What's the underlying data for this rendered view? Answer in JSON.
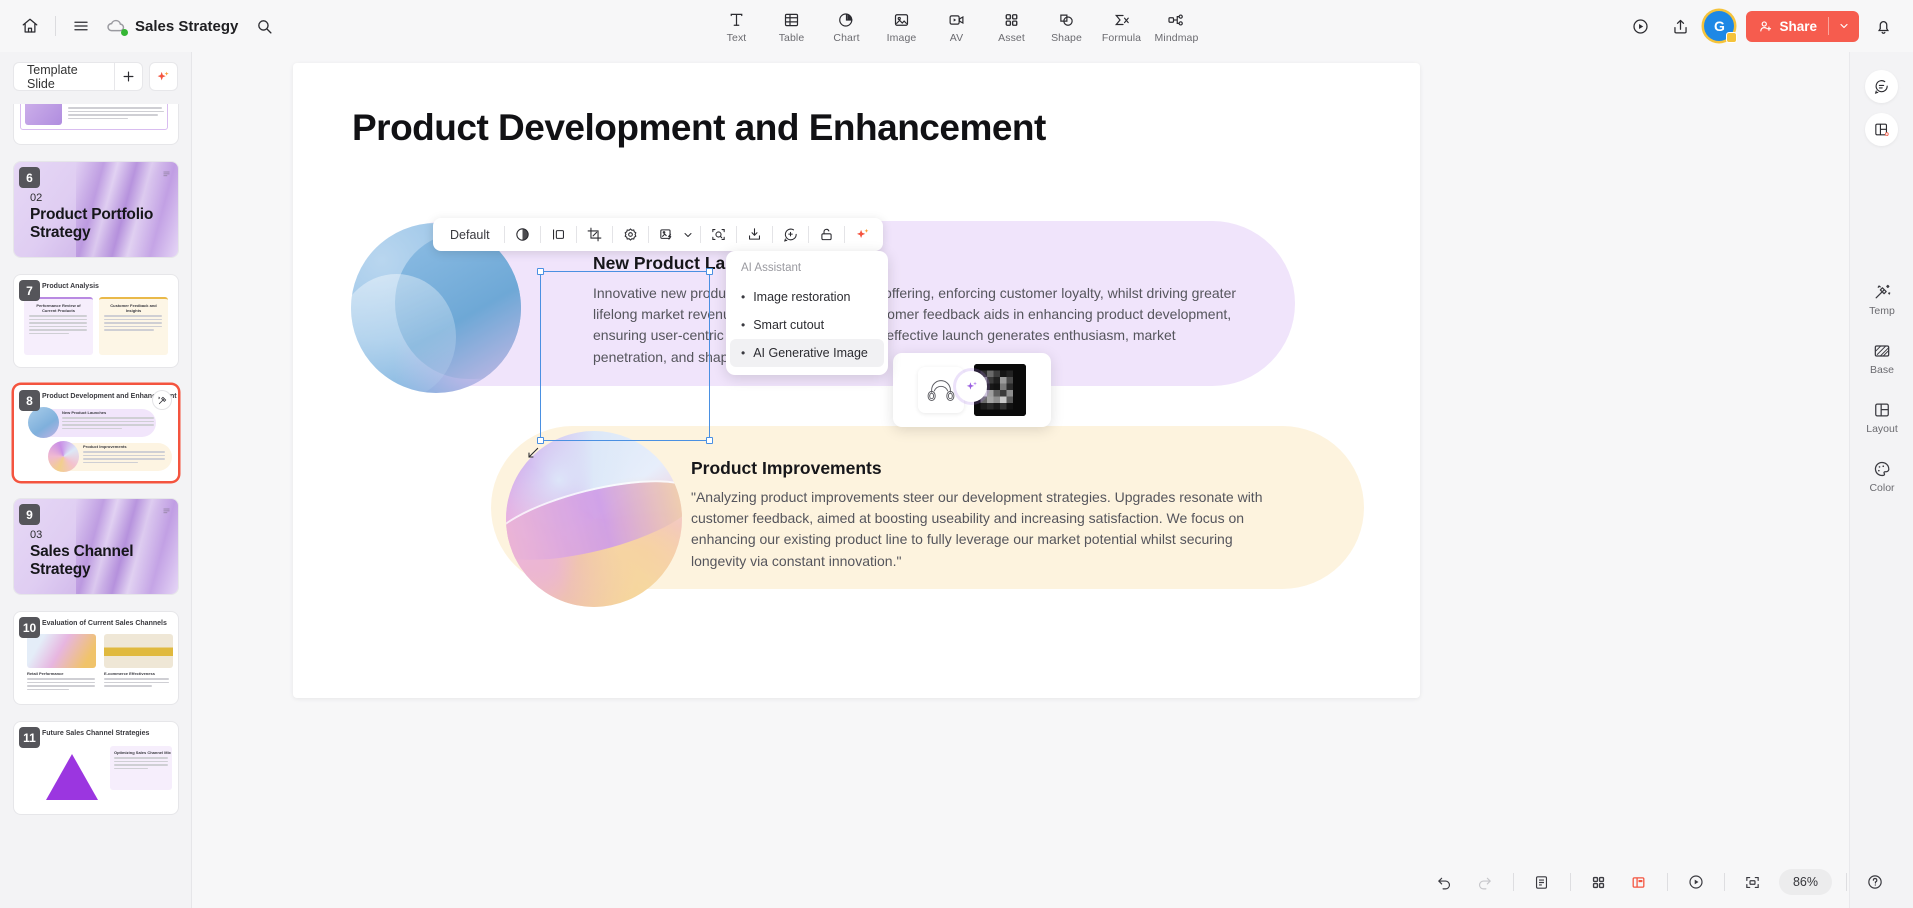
{
  "header": {
    "home_icon": "home-icon",
    "menu_icon": "hamburger-menu-icon",
    "cloud_icon": "cloud-sync-icon",
    "doc_title": "Sales Strategy",
    "search_icon": "search-icon",
    "tools": [
      {
        "label": "Text",
        "icon": "text-icon"
      },
      {
        "label": "Table",
        "icon": "table-icon"
      },
      {
        "label": "Chart",
        "icon": "chart-pie-icon"
      },
      {
        "label": "Image",
        "icon": "image-icon"
      },
      {
        "label": "AV",
        "icon": "video-icon"
      },
      {
        "label": "Asset",
        "icon": "asset-grid-icon"
      },
      {
        "label": "Shape",
        "icon": "shape-icon"
      },
      {
        "label": "Formula",
        "icon": "formula-icon"
      },
      {
        "label": "Mindmap",
        "icon": "mindmap-icon"
      }
    ],
    "present_icon": "play-circle-icon",
    "export_icon": "upload-share-icon",
    "avatar_initial": "G",
    "share_label": "Share",
    "share_color": "#f65c4e",
    "notification_icon": "bell-icon"
  },
  "sidebar": {
    "template_slide_label": "Template Slide",
    "add_slide_icon": "plus-icon",
    "ai_icon": "ai-sparkle-icon",
    "slides": [
      {
        "number": "5",
        "type": "content",
        "title": ""
      },
      {
        "number": "6",
        "type": "cover",
        "kicker": "02",
        "title": "Product Portfolio Strategy"
      },
      {
        "number": "7",
        "type": "content",
        "title": "Product Analysis",
        "cards": [
          "Performance Review of Current Products",
          "Customer Feedback and Insights"
        ]
      },
      {
        "number": "8",
        "type": "content",
        "title": "Product Development and Enhancement",
        "cards": [
          "New Product Launches",
          "Product Improvements"
        ],
        "selected": true
      },
      {
        "number": "9",
        "type": "cover",
        "kicker": "03",
        "title": "Sales Channel Strategy"
      },
      {
        "number": "10",
        "type": "content",
        "title": "Evaluation of Current Sales Channels",
        "cards": [
          "Retail Performance",
          "E-commerce Effectiveness"
        ]
      },
      {
        "number": "11",
        "type": "content",
        "title": "Future Sales Channel Strategies",
        "cards": [
          "Optimizing Sales Channel Mix"
        ]
      }
    ]
  },
  "image_toolbar": {
    "style_label": "Default",
    "items": [
      {
        "icon": "color-filter-icon",
        "name": "filter"
      },
      {
        "icon": "align-icon",
        "name": "align"
      },
      {
        "icon": "crop-icon",
        "name": "crop"
      },
      {
        "icon": "settings-gear-icon",
        "name": "settings"
      },
      {
        "icon": "replace-image-icon",
        "name": "replace-image"
      },
      {
        "icon": "chevron-down-icon",
        "name": "more-image-options"
      },
      {
        "icon": "zoom-preview-icon",
        "name": "preview"
      },
      {
        "icon": "download-icon",
        "name": "download"
      },
      {
        "icon": "add-comment-icon",
        "name": "comment"
      },
      {
        "icon": "unlock-icon",
        "name": "lock"
      },
      {
        "icon": "ai-sparkle-icon",
        "name": "ai-assistant"
      }
    ]
  },
  "ai_menu": {
    "title": "AI Assistant",
    "items": [
      {
        "label": "Image restoration",
        "active": false
      },
      {
        "label": "Smart cutout",
        "active": false
      },
      {
        "label": "AI Generative Image",
        "active": true
      }
    ],
    "preview": {
      "source_icon": "headphones-line-art-icon",
      "transform_icon": "ai-sparkle-icon",
      "result_icon": "generated-image-thumbnail"
    }
  },
  "slide": {
    "title": "Product Development and Enhancement",
    "sections": [
      {
        "heading": "New Product Launches",
        "body": "Innovative new products bolster the diversified offering, enforcing customer loyalty, whilst driving greater lifelong market revenue. Data analysis and customer feedback aids in enhancing product development, ensuring user-centric product development. An effective launch generates enthusiasm, market penetration, and shapes a competitive edge.",
        "accent": "#f0e4fb"
      },
      {
        "heading": "Product Improvements",
        "body": "\"Analyzing product improvements steer our development strategies. Upgrades resonate with customer feedback, aimed at boosting useability and increasing satisfaction. We focus on enhancing our existing product line to fully leverage our market potential whilst securing longevity via constant innovation.\"",
        "accent": "#fdf3de"
      }
    ]
  },
  "right_rail": {
    "top_items": [
      {
        "icon": "comment-icon",
        "name": "comments"
      },
      {
        "icon": "layout-add-icon",
        "name": "insert-layout"
      }
    ],
    "items": [
      {
        "label": "Temp",
        "icon": "template-magic-icon"
      },
      {
        "label": "Base",
        "icon": "base-pattern-icon"
      },
      {
        "label": "Layout",
        "icon": "layout-icon"
      },
      {
        "label": "Color",
        "icon": "color-palette-icon"
      }
    ]
  },
  "bottom_bar": {
    "undo_icon": "undo-icon",
    "redo_icon": "redo-icon",
    "notes_icon": "speaker-notes-icon",
    "grid_icon": "grid-view-icon",
    "layout_view_icon": "layout-view-icon",
    "play_icon": "play-circle-icon",
    "fullscreen_icon": "fullscreen-icon",
    "zoom_level": "86%",
    "help_icon": "help-circle-icon"
  }
}
